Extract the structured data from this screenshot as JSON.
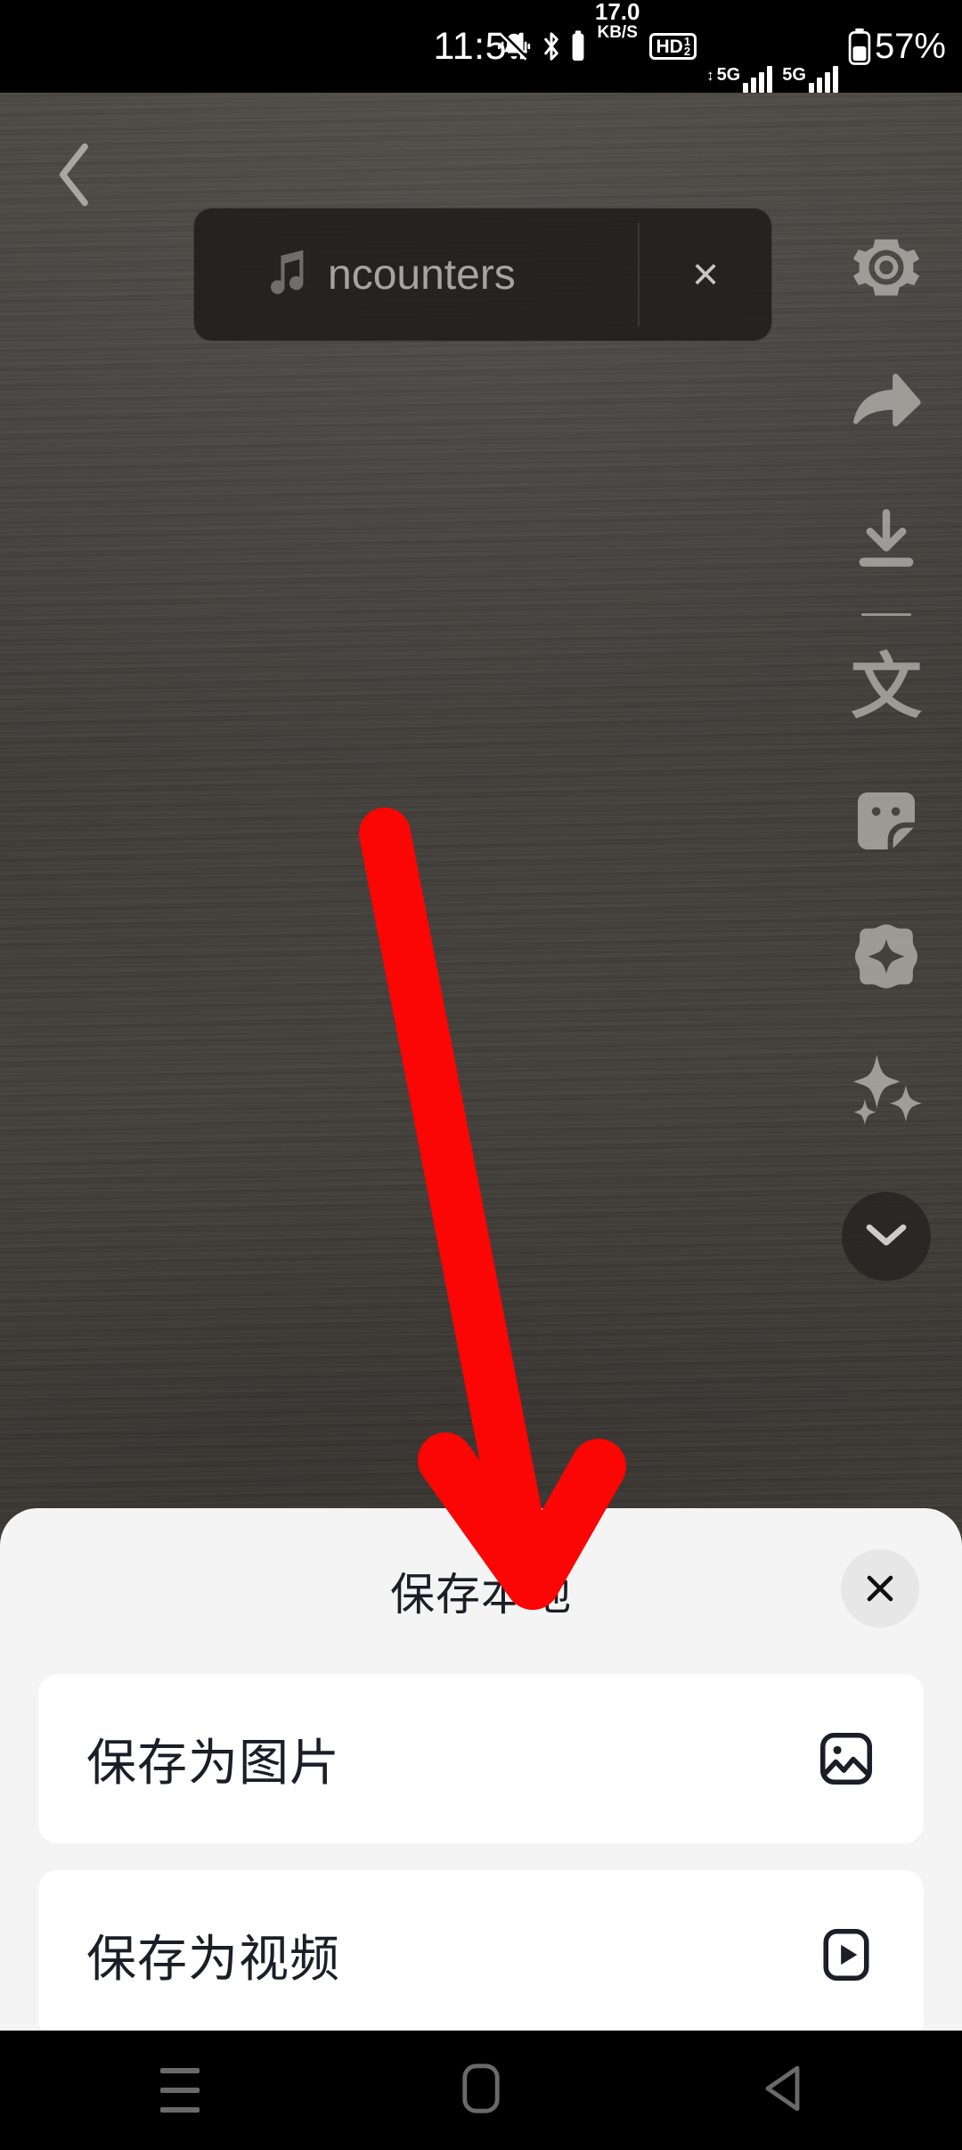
{
  "status_bar": {
    "time": "11:54",
    "network_speed_value": "17.0",
    "network_speed_unit": "KB/S",
    "hd_label": "HD",
    "hd_sup": "1",
    "hd_sub": "2",
    "sim1_network": "5G",
    "sim2_network": "5G",
    "battery_percent": "57%",
    "icons": [
      "mute-icon",
      "bluetooth-icon",
      "network-speed-icon",
      "hd-voice-icon",
      "signal-icon",
      "battery-icon"
    ]
  },
  "top_bar": {
    "back_label": "chevron-left",
    "search": {
      "value": "ncounters",
      "music_icon": "music-note-icon",
      "clear_label": "×"
    },
    "settings_icon": "gear-icon"
  },
  "rail": {
    "items": [
      {
        "name": "gear-icon",
        "label": "Settings"
      },
      {
        "name": "share-icon",
        "label": "Share"
      },
      {
        "name": "download-icon",
        "label": "Download"
      },
      {
        "name": "translate-icon",
        "label": "文"
      },
      {
        "name": "sticker-icon",
        "label": "Sticker"
      },
      {
        "name": "add-icon",
        "label": "Add"
      },
      {
        "name": "sparkle-icon",
        "label": "Effects"
      }
    ],
    "collapse_icon": "chevron-down-icon"
  },
  "annotation": {
    "arrow_color": "#fb0505",
    "arrow_name": "red-pointer-arrow"
  },
  "sheet": {
    "title": "保存本地",
    "close_label": "×",
    "options": [
      {
        "label": "保存为图片",
        "icon": "image-icon"
      },
      {
        "label": "保存为视频",
        "icon": "video-play-icon"
      }
    ]
  },
  "nav_bar": {
    "items": [
      {
        "name": "recents-button",
        "icon": "menu-lines-icon"
      },
      {
        "name": "home-button",
        "icon": "rounded-rect-icon"
      },
      {
        "name": "back-button",
        "icon": "triangle-left-icon"
      }
    ]
  },
  "colors": {
    "sheet_bg": "#f4f4f4",
    "card_bg": "#ffffff",
    "text_dark": "#1b1d27",
    "accent_red": "#fb0505",
    "wood_bg": "#413d39"
  }
}
